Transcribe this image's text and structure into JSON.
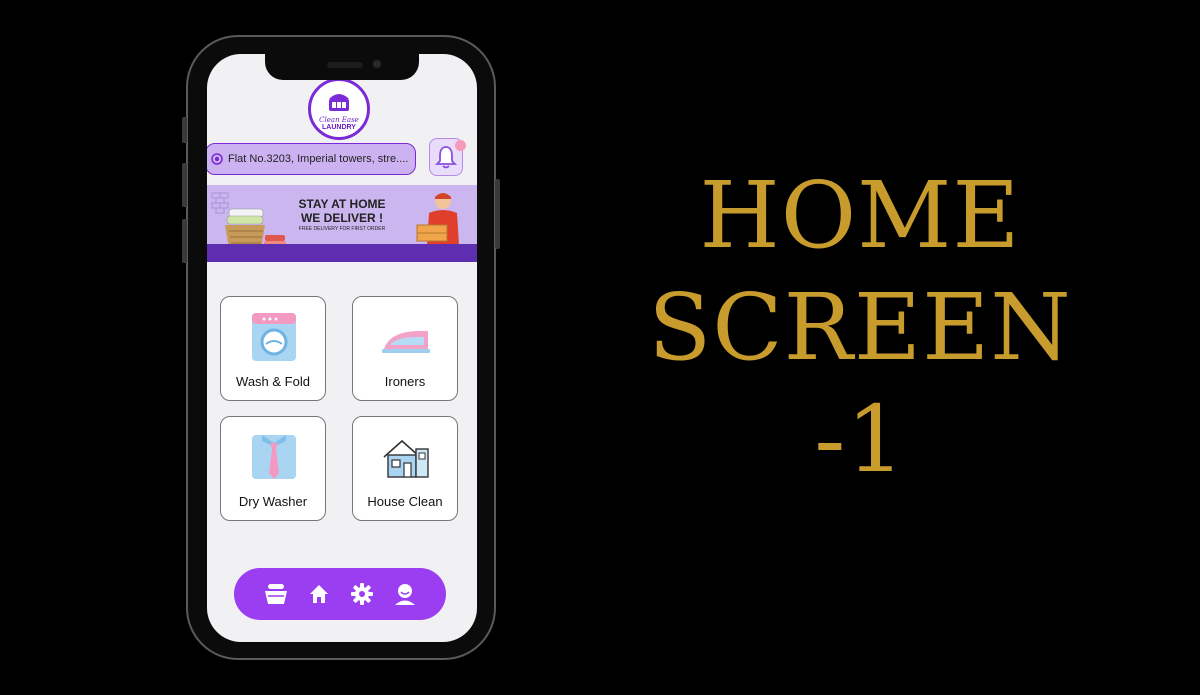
{
  "header": {
    "logo_line1": "Clean Ease",
    "logo_line2": "LAUNDRY"
  },
  "location": {
    "address": "Flat No.3203, Imperial towers, stre...."
  },
  "banner": {
    "title_line1": "STAY AT HOME",
    "title_line2": "WE DELIVER !",
    "subtitle": "FREE DELIVERY FOR FIRST ORDER"
  },
  "services": [
    {
      "label": "Wash & Fold",
      "icon": "washing-machine-icon"
    },
    {
      "label": "Ironers",
      "icon": "iron-icon"
    },
    {
      "label": "Dry Washer",
      "icon": "shirt-tie-icon"
    },
    {
      "label": "House Clean",
      "icon": "house-icon"
    }
  ],
  "bottom_nav": {
    "items": [
      {
        "icon": "laundry-basket-icon"
      },
      {
        "icon": "home-icon"
      },
      {
        "icon": "gear-icon"
      },
      {
        "icon": "profile-icon"
      }
    ]
  },
  "headline": {
    "line1": "HOME",
    "line2": "SCREEN",
    "line3": "-1"
  },
  "colors": {
    "accent": "#9b3df0",
    "gold": "#c79b2c",
    "background": "#000000"
  }
}
